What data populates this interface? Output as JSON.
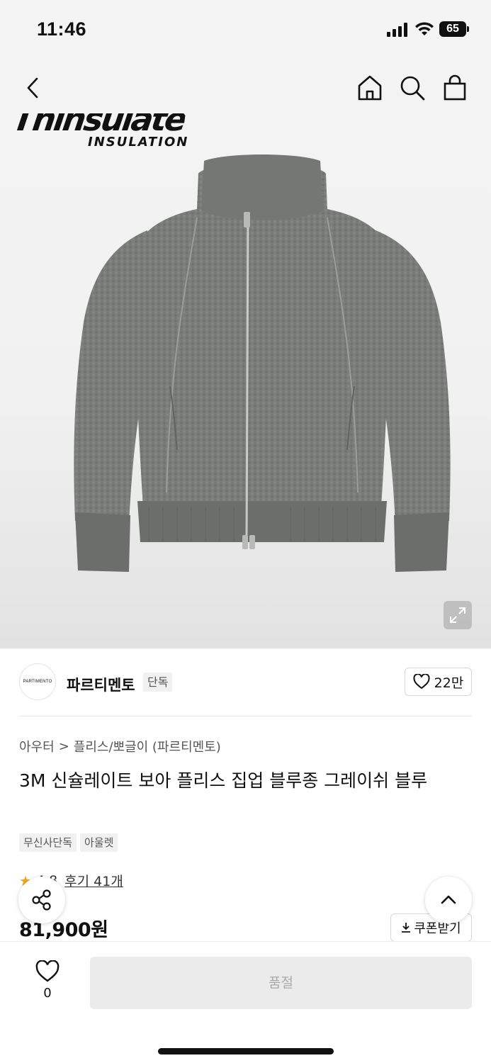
{
  "status_bar": {
    "time": "11:46",
    "battery": "65"
  },
  "hero": {
    "logo_top": "Thinsulate",
    "logo_sub": "INSULATION",
    "icons": [
      "chevron-left-icon",
      "home-icon",
      "search-icon",
      "shopping-bag-icon",
      "expand-icon"
    ]
  },
  "brand": {
    "avatar_text": "PARTIMENTO",
    "name": "파르티멘토",
    "badge": "단독",
    "like_count": "22만"
  },
  "breadcrumb": {
    "category": "아우터",
    "separator": ">",
    "subcategory": "플리스/뽀글이 (파르티멘토)"
  },
  "product": {
    "title": "3M 신슐레이트 보아 플리스 집업 블루종 그레이쉬 블루",
    "tags": [
      "무신사단독",
      "아울렛"
    ],
    "rating": "4.8",
    "reviews": "후기 41개",
    "price": "81,900원",
    "coupon_label": "쿠폰받기"
  },
  "bottom_bar": {
    "wish_count": "0",
    "action_label": "품절"
  },
  "colors": {
    "star": "#f3a21b",
    "soldout_bg": "#ebebeb",
    "soldout_text": "#a9a9a9",
    "jacket": "#7b7d7b"
  }
}
